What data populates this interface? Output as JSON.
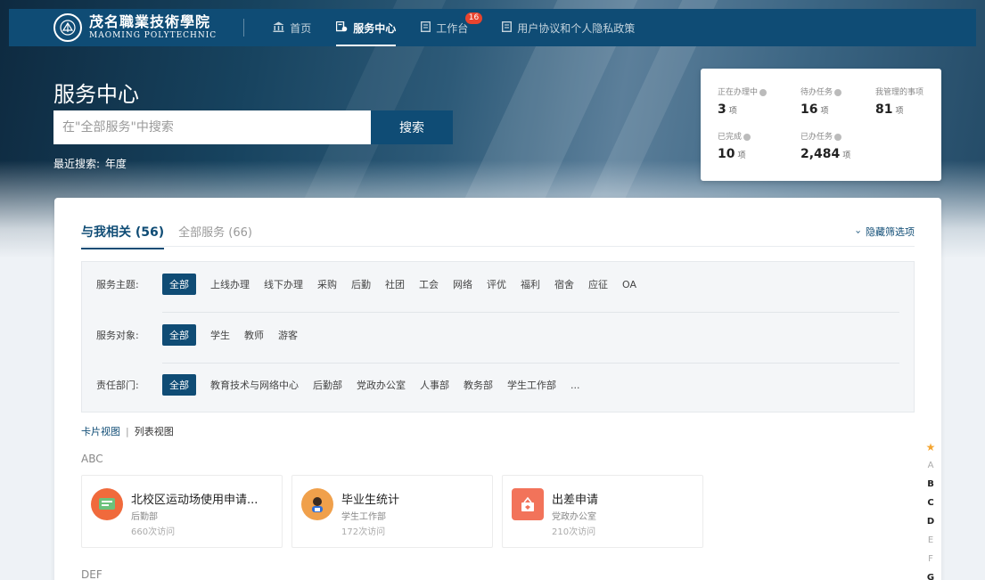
{
  "nav": {
    "logo_cn": "茂名職業技術學院",
    "logo_en": "MAOMING POLYTECHNIC",
    "items": [
      {
        "label": "首页",
        "icon": "bank-icon"
      },
      {
        "label": "服务中心",
        "icon": "service-icon",
        "active": true
      },
      {
        "label": "工作台",
        "icon": "workbench-icon",
        "badge": "16"
      },
      {
        "label": "用户协议和个人隐私政策",
        "icon": "document-icon"
      }
    ]
  },
  "hero": {
    "title": "服务中心",
    "search_placeholder": "在\"全部服务\"中搜索",
    "search_button": "搜索",
    "recent_label": "最近搜索:",
    "recent_value": "年度"
  },
  "stats": [
    {
      "label": "正在办理中",
      "value": "3",
      "unit": "项"
    },
    {
      "label": "待办任务",
      "value": "16",
      "unit": "项"
    },
    {
      "label": "我管理的事项",
      "value": "81",
      "unit": "项"
    },
    {
      "label": "已完成",
      "value": "10",
      "unit": "项"
    },
    {
      "label": "已办任务",
      "value": "2,484",
      "unit": "项"
    }
  ],
  "tabs": [
    {
      "label": "与我相关 (56)",
      "active": true
    },
    {
      "label": "全部服务 (66)",
      "active": false
    }
  ],
  "hide_filter_label": "隐藏筛选项",
  "filters": [
    {
      "label": "服务主题:",
      "options": [
        "全部",
        "上线办理",
        "线下办理",
        "采购",
        "后勤",
        "社团",
        "工会",
        "网络",
        "评优",
        "福利",
        "宿舍",
        "应征",
        "OA"
      ]
    },
    {
      "label": "服务对象:",
      "options": [
        "全部",
        "学生",
        "教师",
        "游客"
      ]
    },
    {
      "label": "责任部门:",
      "options": [
        "全部",
        "教育技术与网络中心",
        "后勤部",
        "党政办公室",
        "人事部",
        "教务部",
        "学生工作部",
        "..."
      ]
    }
  ],
  "view_toggle": {
    "card": "卡片视图",
    "list": "列表视图"
  },
  "groups": [
    {
      "title": "ABC",
      "cards": [
        {
          "title": "北校区运动场使用申请...",
          "dept": "后勤部",
          "visits": "660次访问",
          "color": "#f06a3c"
        },
        {
          "title": "毕业生统计",
          "dept": "学生工作部",
          "visits": "172次访问",
          "color": "#f0a04b"
        },
        {
          "title": "出差申请",
          "dept": "党政办公室",
          "visits": "210次访问",
          "color": "#f2735a"
        }
      ]
    },
    {
      "title": "DEF",
      "cards": []
    }
  ],
  "alphabet": {
    "star": "★",
    "letters": [
      {
        "l": "A",
        "bold": false
      },
      {
        "l": "B",
        "bold": true
      },
      {
        "l": "C",
        "bold": true
      },
      {
        "l": "D",
        "bold": true
      },
      {
        "l": "E",
        "bold": false
      },
      {
        "l": "F",
        "bold": false
      },
      {
        "l": "G",
        "bold": true
      }
    ]
  }
}
